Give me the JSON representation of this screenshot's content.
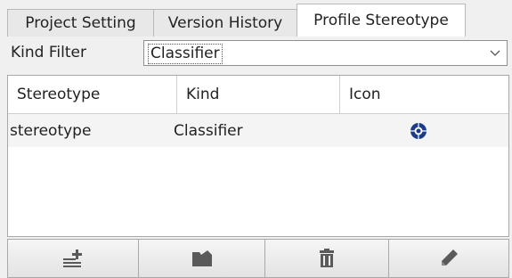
{
  "tabs": [
    {
      "label": "Project Setting",
      "active": false
    },
    {
      "label": "Version History",
      "active": false
    },
    {
      "label": "Profile Stereotype",
      "active": true
    }
  ],
  "filter": {
    "label": "Kind Filter",
    "value": "Classifier"
  },
  "table": {
    "columns": [
      "Stereotype",
      "Kind",
      "Icon"
    ],
    "rows": [
      {
        "stereotype": "stereotype",
        "kind": "Classifier",
        "icon": "stereotype-icon"
      }
    ]
  },
  "toolbar": {
    "buttons": [
      "add-icon",
      "folder-icon",
      "trash-icon",
      "pen-icon"
    ]
  },
  "colors": {
    "icon_blue": "#1c3b8a",
    "toolbar_icon": "#5a5a5a"
  }
}
